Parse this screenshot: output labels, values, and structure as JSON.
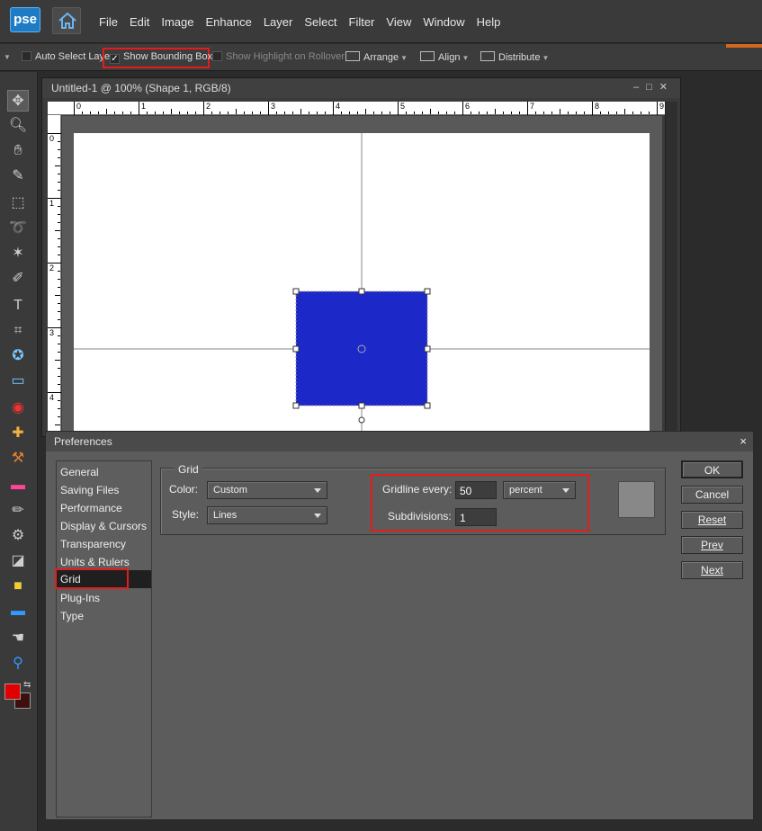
{
  "app": {
    "logo": "pse"
  },
  "menu": [
    "File",
    "Edit",
    "Image",
    "Enhance",
    "Layer",
    "Select",
    "Filter",
    "View",
    "Window",
    "Help"
  ],
  "options": {
    "auto_select_layer": "Auto Select Layer",
    "show_bounding_box": "Show Bounding Box",
    "show_highlight": "Show Highlight on Rollover",
    "arrange": "Arrange",
    "align": "Align",
    "distribute": "Distribute"
  },
  "document": {
    "title": "Untitled-1 @ 100% (Shape 1, RGB/8)",
    "ruler_h": [
      "0",
      "1",
      "2",
      "3",
      "4",
      "5",
      "6",
      "7",
      "8",
      "9"
    ],
    "ruler_v": [
      "0",
      "1",
      "2",
      "3",
      "4"
    ],
    "shape_color": "#1c28c8"
  },
  "prefs": {
    "title": "Preferences",
    "close": "×",
    "categories": [
      "General",
      "Saving Files",
      "Performance",
      "Display & Cursors",
      "Transparency",
      "Units & Rulers",
      "Grid",
      "Plug-Ins",
      "Type"
    ],
    "selected_category": "Grid",
    "grid_group": "Grid",
    "color_label": "Color:",
    "color_value": "Custom",
    "style_label": "Style:",
    "style_value": "Lines",
    "gridline_label": "Gridline every:",
    "gridline_value": "50",
    "gridline_unit": "percent",
    "subdivisions_label": "Subdivisions:",
    "subdivisions_value": "1",
    "buttons": {
      "ok": "OK",
      "cancel": "Cancel",
      "reset": "Reset",
      "prev": "Prev",
      "next": "Next"
    }
  },
  "colors": {
    "highlight": "#e31c1c",
    "foreground": "#e00000",
    "background": "#3d0f0f"
  }
}
